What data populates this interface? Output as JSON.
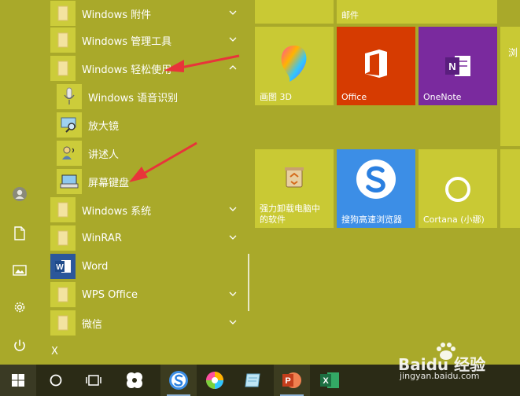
{
  "start_menu": {
    "left_rail": {
      "items": [
        {
          "icon": "user-icon"
        },
        {
          "icon": "document-icon"
        },
        {
          "icon": "pictures-icon"
        },
        {
          "icon": "settings-icon"
        },
        {
          "icon": "power-icon"
        }
      ]
    },
    "app_list": {
      "items": [
        {
          "label": "Windows 附件",
          "icon": "folder-icon",
          "expand": "down"
        },
        {
          "label": "Windows 管理工具",
          "icon": "folder-icon",
          "expand": "down"
        },
        {
          "label": "Windows 轻松使用",
          "icon": "folder-icon",
          "expand": "up"
        },
        {
          "label": "Windows 语音识别",
          "icon": "microphone-icon"
        },
        {
          "label": "放大镜",
          "icon": "magnifier-icon"
        },
        {
          "label": "讲述人",
          "icon": "narrator-icon"
        },
        {
          "label": "屏幕键盘",
          "icon": "keyboard-icon"
        },
        {
          "label": "Windows 系统",
          "icon": "folder-icon",
          "expand": "down"
        },
        {
          "label": "WinRAR",
          "icon": "folder-icon",
          "expand": "down"
        },
        {
          "label": "Word",
          "icon": "word-icon"
        },
        {
          "label": "WPS Office",
          "icon": "folder-icon",
          "expand": "down"
        },
        {
          "label": "微信",
          "icon": "folder-icon",
          "expand": "down"
        }
      ],
      "next_letter": "X"
    },
    "tiles": {
      "mail": {
        "label": "邮件"
      },
      "paint3d": {
        "label": "画图 3D"
      },
      "office": {
        "label": "Office"
      },
      "onenote": {
        "label": "OneNote"
      },
      "uninstall": {
        "label_line1": "强力卸载电脑中",
        "label_line2": "的软件"
      },
      "sogou": {
        "label": "搜狗高速浏览器"
      },
      "cortana": {
        "label": "Cortana (小娜)"
      },
      "partial_right": {
        "label": "浏"
      }
    },
    "colors": {
      "background": "#a9a92a",
      "tile": "#c9c934",
      "office": "#d63b01",
      "onenote": "#7a2a9e",
      "sogou": "#3c8ee6",
      "taskbar": "#2b2b16"
    }
  },
  "taskbar": {
    "items": [
      {
        "icon": "windows-start-icon"
      },
      {
        "icon": "cortana-circle-icon"
      },
      {
        "icon": "task-view-icon"
      },
      {
        "icon": "fan-app-icon"
      },
      {
        "icon": "sogou-browser-icon"
      },
      {
        "icon": "paint3d-icon"
      },
      {
        "icon": "notepad-icon"
      },
      {
        "icon": "powerpoint-icon"
      },
      {
        "icon": "excel-icon"
      }
    ]
  },
  "watermark": {
    "line1": "Baidu 经验",
    "line2": "jingyan.baidu.com"
  }
}
